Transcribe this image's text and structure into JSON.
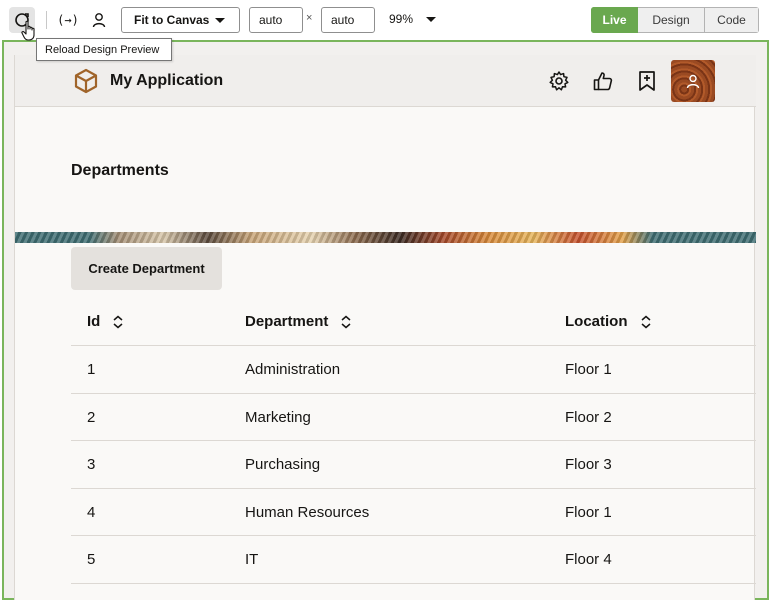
{
  "toolbar": {
    "reload_icon": "reload-icon",
    "variables_label": "(→)",
    "fit_option": "Fit to Canvas",
    "width_value": "auto",
    "height_value": "auto",
    "dimension_separator": "×",
    "zoom": "99%",
    "modes": {
      "live": "Live",
      "design": "Design",
      "code": "Code"
    },
    "active_mode": "Live",
    "accent_color": "#6aa84f"
  },
  "tooltip": "Reload Design Preview",
  "app": {
    "title": "My Application",
    "page_title": "Departments",
    "create_button": "Create Department"
  },
  "table": {
    "columns": [
      "Id",
      "Department",
      "Location"
    ],
    "rows": [
      {
        "id": "1",
        "department": "Administration",
        "location": "Floor 1"
      },
      {
        "id": "2",
        "department": "Marketing",
        "location": "Floor 2"
      },
      {
        "id": "3",
        "department": "Purchasing",
        "location": "Floor 3"
      },
      {
        "id": "4",
        "department": "Human Resources",
        "location": "Floor 1"
      },
      {
        "id": "5",
        "department": "IT",
        "location": "Floor 4"
      }
    ]
  }
}
